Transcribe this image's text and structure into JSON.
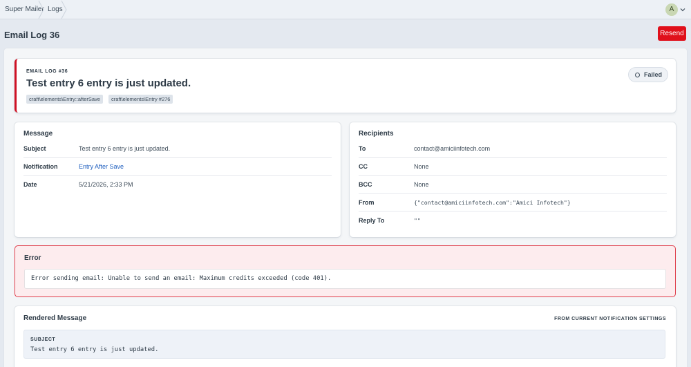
{
  "breadcrumb": [
    "Super Mailer",
    "Logs"
  ],
  "account": {
    "initial": "A"
  },
  "page": {
    "title": "Email Log 36",
    "resend_label": "Resend"
  },
  "log": {
    "eyebrow": "EMAIL LOG #36",
    "title": "Test entry 6 entry is just updated.",
    "tags": [
      "craft\\elements\\Entry::afterSave",
      "craft\\elements\\Entry #276"
    ],
    "status": "Failed",
    "accent_color": "#cf1124"
  },
  "message": {
    "heading": "Message",
    "rows": [
      {
        "label": "Subject",
        "value": "Test entry 6 entry is just updated."
      },
      {
        "label": "Notification",
        "value": "Entry After Save"
      },
      {
        "label": "Date",
        "value": "5/21/2026, 2:33 PM"
      }
    ]
  },
  "recipients": {
    "heading": "Recipients",
    "rows": [
      {
        "label": "To",
        "value": "contact@amiciinfotech.com"
      },
      {
        "label": "CC",
        "value": "None"
      },
      {
        "label": "BCC",
        "value": "None"
      },
      {
        "label": "From",
        "value": "{\"contact@amiciinfotech.com\":\"Amici Infotech\"}"
      },
      {
        "label": "Reply To",
        "value": "\"\""
      }
    ]
  },
  "error": {
    "heading": "Error",
    "text": "Error sending email: Unable to send an email: Maximum credits exceeded (code 401)."
  },
  "rendered": {
    "heading": "Rendered Message",
    "note": "FROM CURRENT NOTIFICATION SETTINGS",
    "subject_label": "SUBJECT",
    "subject_value": "Test entry 6 entry is just updated."
  },
  "colors": {
    "resend": "#e0101b",
    "link": "#1f5fbf",
    "error_bg": "#fdecee",
    "error_border": "#df3b48"
  },
  "icons": [
    "chevron-right-icon",
    "chevron-down-icon",
    "status-circle-icon"
  ]
}
